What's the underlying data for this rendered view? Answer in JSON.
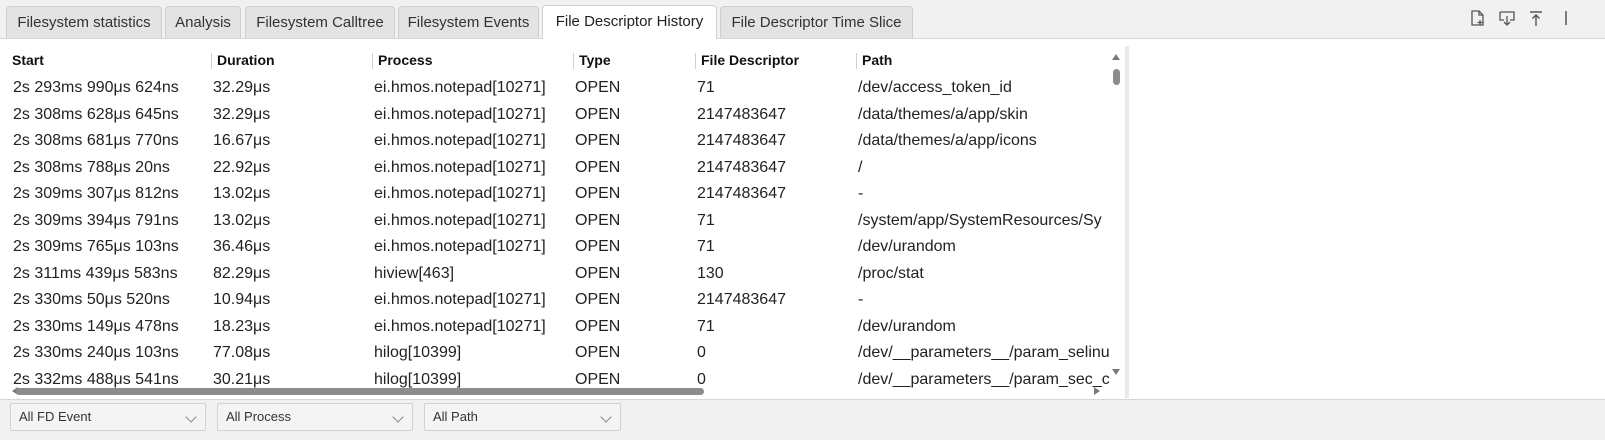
{
  "tabs": [
    {
      "label": "Filesystem statistics",
      "active": false
    },
    {
      "label": "Analysis",
      "active": false
    },
    {
      "label": "Filesystem Calltree",
      "active": false
    },
    {
      "label": "Filesystem Events",
      "active": false
    },
    {
      "label": "File Descriptor History",
      "active": true
    },
    {
      "label": "File Descriptor Time Slice",
      "active": false
    }
  ],
  "toolbar_icons": [
    "new-file-icon",
    "download-icon",
    "upload-top-icon",
    "vertical-bar-icon"
  ],
  "columns": [
    "Start",
    "Duration",
    "Process",
    "Type",
    "File Descriptor",
    "Path"
  ],
  "rows": [
    [
      "2s 293ms 990μs 624ns",
      "32.29μs",
      "ei.hmos.notepad[10271]",
      "OPEN",
      "71",
      "/dev/access_token_id"
    ],
    [
      "2s 308ms 628μs 645ns",
      "32.29μs",
      "ei.hmos.notepad[10271]",
      "OPEN",
      "2147483647",
      "/data/themes/a/app/skin"
    ],
    [
      "2s 308ms 681μs 770ns",
      "16.67μs",
      "ei.hmos.notepad[10271]",
      "OPEN",
      "2147483647",
      "/data/themes/a/app/icons"
    ],
    [
      "2s 308ms 788μs 20ns",
      "22.92μs",
      "ei.hmos.notepad[10271]",
      "OPEN",
      "2147483647",
      "/"
    ],
    [
      "2s 309ms 307μs 812ns",
      "13.02μs",
      "ei.hmos.notepad[10271]",
      "OPEN",
      "2147483647",
      "-"
    ],
    [
      "2s 309ms 394μs 791ns",
      "13.02μs",
      "ei.hmos.notepad[10271]",
      "OPEN",
      "71",
      "/system/app/SystemResources/Sy"
    ],
    [
      "2s 309ms 765μs 103ns",
      "36.46μs",
      "ei.hmos.notepad[10271]",
      "OPEN",
      "71",
      "/dev/urandom"
    ],
    [
      "2s 311ms 439μs 583ns",
      "82.29μs",
      "hiview[463]",
      "OPEN",
      "130",
      "/proc/stat"
    ],
    [
      "2s 330ms 50μs 520ns",
      "10.94μs",
      "ei.hmos.notepad[10271]",
      "OPEN",
      "2147483647",
      "-"
    ],
    [
      "2s 330ms 149μs 478ns",
      "18.23μs",
      "ei.hmos.notepad[10271]",
      "OPEN",
      "71",
      "/dev/urandom"
    ],
    [
      "2s 330ms 240μs 103ns",
      "77.08μs",
      "hilog[10399]",
      "OPEN",
      "0",
      "/dev/__parameters__/param_selinu"
    ],
    [
      "2s 332ms 488μs 541ns",
      "30.21μs",
      "hilog[10399]",
      "OPEN",
      "0",
      "/dev/__parameters__/param_sec_c"
    ]
  ],
  "filters": [
    {
      "selected": "All FD Event"
    },
    {
      "selected": "All Process"
    },
    {
      "selected": "All Path"
    }
  ]
}
